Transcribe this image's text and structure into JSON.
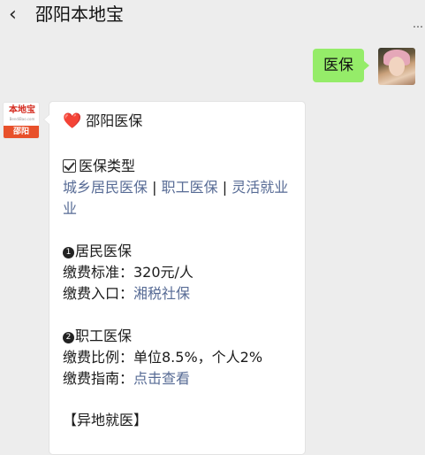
{
  "header": {
    "back_icon": "chevron-left-icon",
    "title": "邵阳本地宝",
    "more_icon": "more-dots-icon"
  },
  "outgoing": {
    "text": "医保"
  },
  "incoming": {
    "sender_logo_text": "本地宝",
    "sender_logo_sub": "BendiBao.com",
    "sender_logo_city": "邵阳",
    "heading": "邵阳医保",
    "heading_icon": "heart-icon",
    "types_title": "医保类型",
    "types_icon": "checkbox-icon",
    "type_links": [
      "城乡居民医保",
      "职工医保",
      "灵活就业"
    ],
    "type_link_wrap": "业",
    "separator": "|",
    "resident": {
      "number": "1",
      "title": "居民医保",
      "fee_label": "缴费标准：320元/人",
      "entry_label": "缴费入口：",
      "entry_link": "湘税社保"
    },
    "employee": {
      "number": "2",
      "title": "职工医保",
      "ratio_label": "缴费比例：单位8.5%，个人2%",
      "guide_label": "缴费指南：",
      "guide_link": "点击查看"
    },
    "offsite_title": "【异地就医】"
  }
}
